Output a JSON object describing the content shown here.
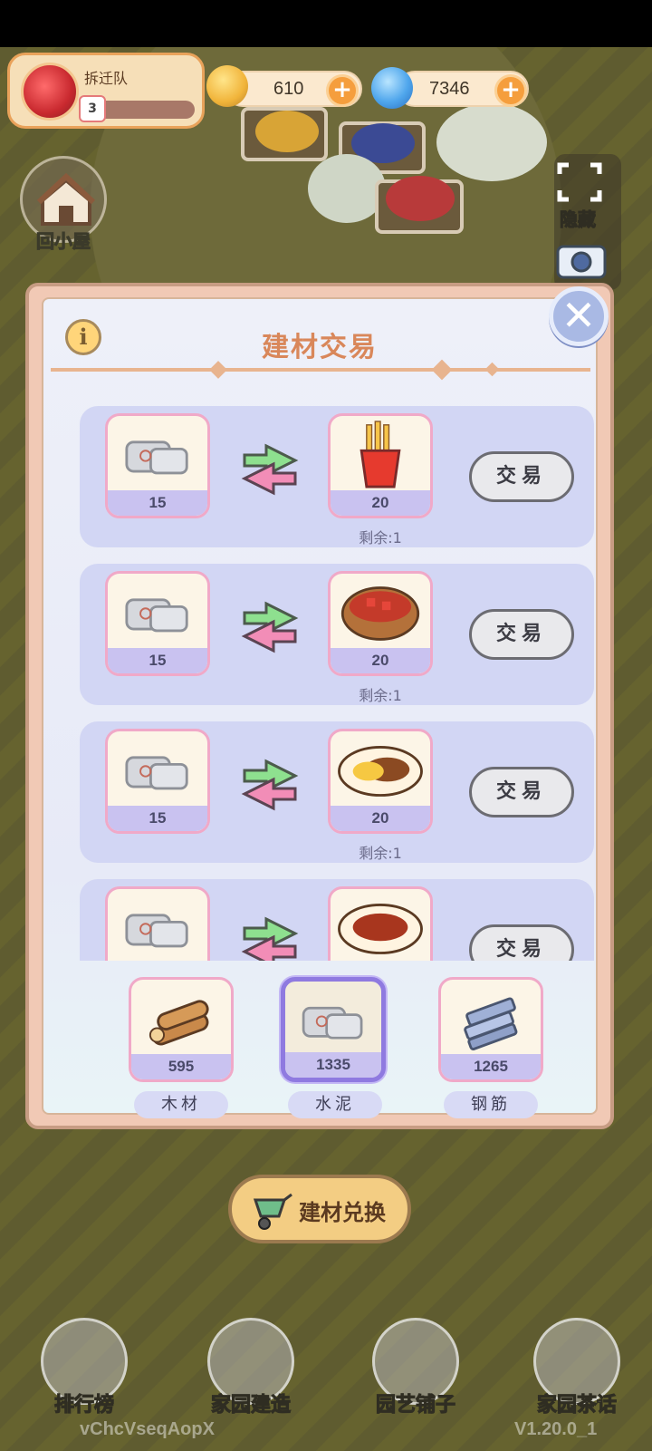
{
  "player": {
    "name": "拆迁队",
    "level": "3",
    "level_progress": 0.08
  },
  "currencies": [
    {
      "name": "gold-coin",
      "value": "610"
    },
    {
      "name": "blue-gem",
      "value": "7346"
    }
  ],
  "side_buttons": {
    "home": "回小屋",
    "hide": "隐藏"
  },
  "dialog": {
    "title": "建材交易",
    "trades": [
      {
        "give_qty": "15",
        "get_item": "fries-icon",
        "get_qty": "20",
        "remaining": "剩余:1",
        "button": "交易"
      },
      {
        "give_qty": "15",
        "get_item": "stew-pot-icon",
        "get_qty": "20",
        "remaining": "剩余:1",
        "button": "交易"
      },
      {
        "give_qty": "15",
        "get_item": "curry-plate-icon",
        "get_qty": "20",
        "remaining": "剩余:1",
        "button": "交易"
      },
      {
        "give_qty": "",
        "get_item": "meat-plate-icon",
        "get_qty": "",
        "remaining": "",
        "button": "交易"
      }
    ],
    "materials": [
      {
        "name": "木材",
        "count": "595",
        "icon": "wood-logs-icon",
        "selected": false
      },
      {
        "name": "水泥",
        "count": "1335",
        "icon": "cement-bags-icon",
        "selected": true
      },
      {
        "name": "钢筋",
        "count": "1265",
        "icon": "steel-bars-icon",
        "selected": false
      }
    ]
  },
  "exchange_button": "建材兑换",
  "bottom_nav": [
    "排行榜",
    "家园建造",
    "园艺铺子",
    "家园茶话"
  ],
  "footer": {
    "user_id": "vChcVseqAopX",
    "version": "V1.20.0_1"
  },
  "colors": {
    "accent": "#d9875a",
    "selected": "#8f7ae0",
    "row_bg": "#d2d6f4"
  }
}
